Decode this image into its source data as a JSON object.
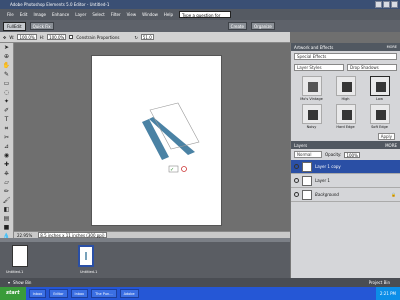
{
  "window": {
    "title": "Adobe Photoshop Elements 5.0 Editor - Untitled-1"
  },
  "menu": {
    "items": [
      "File",
      "Edit",
      "Image",
      "Enhance",
      "Layer",
      "Select",
      "Filter",
      "View",
      "Window",
      "Help"
    ],
    "help_placeholder": "Type a question for help"
  },
  "toolbar": {
    "new_label": "Create",
    "full_edit": "FullEdit",
    "quick_fix": "Quick Fix",
    "create": "Create",
    "organize": "Organize"
  },
  "options": {
    "w_label": "W:",
    "w_value": "100.0%",
    "h_label": "H:",
    "h_value": "100.0%",
    "constrain": "Constrain Proportions",
    "angle_value": "51.0"
  },
  "status": {
    "zoom": "22.95%",
    "doc_size": "8.5 inches x 11 inches (300 ppi)"
  },
  "bin": {
    "files": [
      {
        "name": "Untitled-1"
      },
      {
        "name": "Untitled-1"
      }
    ],
    "show_bin": "Show Bin",
    "project_bin": "Project Bin"
  },
  "artwork": {
    "title": "Artwork and Effects",
    "more": "MORE",
    "select_1": "Special Effects",
    "select_2": "Layer Styles",
    "select_3": "Drop Shadows",
    "effects": [
      {
        "label": "Mo's Vintage"
      },
      {
        "label": "High"
      },
      {
        "label": "Low"
      },
      {
        "label": "Noisy"
      },
      {
        "label": "Hard Edge"
      },
      {
        "label": "Soft Edge"
      }
    ],
    "apply": "Apply"
  },
  "layers": {
    "title": "Layers",
    "more": "MORE",
    "blend": "Normal",
    "opacity_label": "Opacity:",
    "opacity_value": "100%",
    "rows": [
      {
        "name": "Layer 1 copy",
        "active": true
      },
      {
        "name": "Layer 1",
        "active": false
      },
      {
        "name": "Background",
        "active": false
      }
    ]
  },
  "taskbar": {
    "start": "start",
    "tasks": [
      "Inbox",
      "Editor",
      "Inbox",
      "The Pun...",
      "Adobe"
    ],
    "clock": "2:21 PM"
  },
  "colors": {
    "accent": "#2a4fa5",
    "canvas_bg": "#6f6f6f",
    "shape_fill": "#4a82a4"
  }
}
